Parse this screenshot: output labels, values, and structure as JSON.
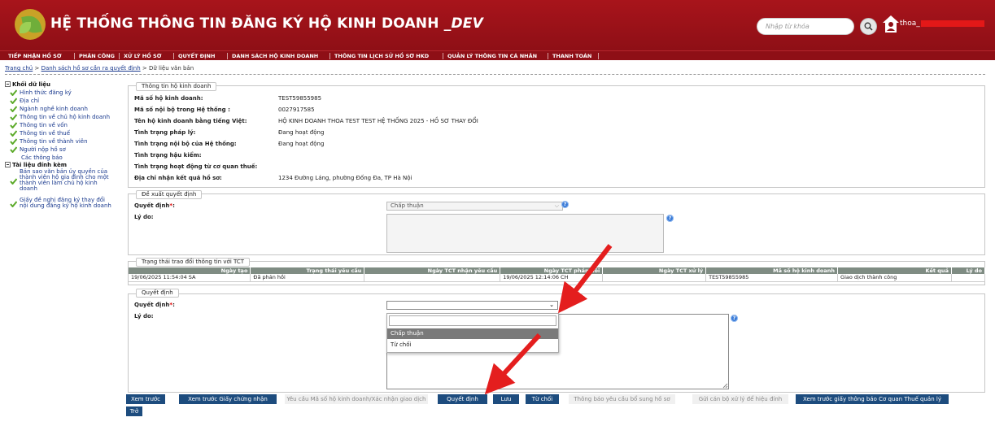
{
  "header": {
    "title": "HỆ THỐNG THÔNG TIN ĐĂNG KÝ HỘ KINH DOANH ",
    "title_suffix": "_DEV",
    "search_placeholder": "Nhập từ khóa",
    "user_name": "thoa_",
    "brand_color": "#a8141b"
  },
  "menu": [
    "TIẾP NHẬN HỒ SƠ",
    "PHÂN CÔNG",
    "XỬ LÝ HỒ SƠ",
    "QUYẾT ĐỊNH",
    "DANH SÁCH HỘ KINH DOANH",
    "THÔNG TIN LỊCH SỬ HỒ SƠ HKD",
    "QUẢN LÝ THÔNG TIN CÁ NHÂN",
    "THANH TOÁN"
  ],
  "breadcrumb": {
    "home": "Trang chủ",
    "sep": " > ",
    "list": "Danh sách hồ sơ cần ra quyết định",
    "current": " > Dữ liệu văn bản"
  },
  "tree": {
    "group1": "Khối dữ liệu",
    "group1_items": [
      "Hình thức đăng ký",
      "Địa chỉ",
      "Ngành nghề kinh doanh",
      "Thông tin về chủ hộ kinh doanh",
      "Thông tin về vốn",
      "Thông tin về thuế",
      "Thông tin về thành viên",
      "Người nộp hồ sơ",
      "Các thông báo"
    ],
    "group2": "Tài liệu đính kèm",
    "group2_items": [
      [
        "Bản sao văn bản ủy quyền của",
        "thành viên hộ gia đình cho một",
        "thành viên làm chủ hộ kinh",
        "doanh"
      ],
      [
        "Giấy đề nghị đăng ký thay đổi",
        "nội dung đăng ký hộ kinh doanh"
      ]
    ]
  },
  "business_info": {
    "legend": "Thông tin hộ kinh doanh",
    "fields": [
      {
        "label": "Mã số hộ kinh doanh:",
        "value": "TEST59855985"
      },
      {
        "label": "Mã số nội bộ trong Hệ thống :",
        "value": "0027917585"
      },
      {
        "label": "Tên hộ kinh doanh bằng tiếng Việt:",
        "value": "HỘ KINH DOANH THOA TEST TEST HỆ THỐNG 2025 - HỒ SƠ THAY ĐỔI"
      },
      {
        "label": "Tình trạng pháp lý:",
        "value": "Đang hoạt động"
      },
      {
        "label": "Tình trạng nội bộ của Hệ thống:",
        "value": "Đang hoạt động"
      },
      {
        "label": "Tình trạng hậu kiểm:",
        "value": ""
      },
      {
        "label": "Tình trạng hoạt động từ cơ quan thuế:",
        "value": ""
      },
      {
        "label": "Địa chỉ nhận kết quả hồ sơ:",
        "value": "1234 Đường Láng, phường Đống Đa, TP Hà Nội"
      }
    ]
  },
  "proposal": {
    "legend": "Đề xuất quyết định",
    "decision_label": "Quyết định",
    "required_mark": "*",
    "colon": ":",
    "decision_value": "Chấp thuận",
    "reason_label": "Lý do:"
  },
  "tct": {
    "legend": "Trạng thái trao đổi thông tin với TCT",
    "columns": [
      "Ngày tạo",
      "Trạng thái yêu cầu",
      "Ngày TCT nhận yêu cầu",
      "Ngày TCT phản hồi",
      "Ngày TCT xử lý",
      "Mã số hộ kinh doanh",
      "Kết quả",
      "Lý do"
    ],
    "rows": [
      [
        "19/06/2025 11:54:04 SA",
        "Đã phản hồi",
        "",
        "19/06/2025 12:14:06 CH",
        "",
        "TEST59855985",
        "Giao dịch thành công",
        ""
      ]
    ]
  },
  "decision": {
    "legend": "Quyết định",
    "decision_label": "Quyết định",
    "required_mark": "*",
    "colon": ":",
    "decision_value": "",
    "reason_label": "Lý do:",
    "options": [
      "Chấp thuận",
      "Từ chối"
    ],
    "highlighted_option": "Chấp thuận"
  },
  "buttons": {
    "preview": "Xem trước",
    "preview_cert": "Xem trước Giấy chứng nhận",
    "request_tax": "Yêu cầu Mã số hộ kinh doanh/Xác nhận giao dịch",
    "decide": "Quyết định",
    "save": "Lưu",
    "reject": "Từ chối",
    "notify_supplement": "Thông báo yêu cầu bổ sung hồ sơ",
    "send_invalid": "Gửi cán bộ xử lý để hiệu đính",
    "preview_tax_notice": "Xem trước giấy thông báo Cơ quan Thuế quản lý",
    "back": "Trở về"
  },
  "colors": {
    "menubar": "#8e0f16",
    "button": "#1d4c7e",
    "table_header": "#7f8c83",
    "arrow": "#e41e1e"
  }
}
